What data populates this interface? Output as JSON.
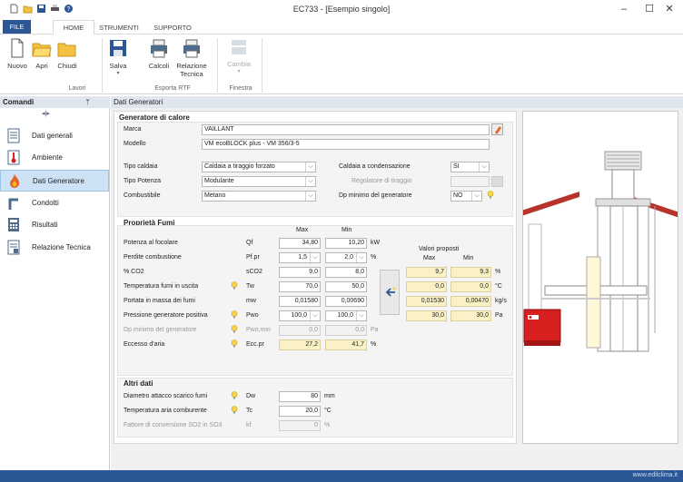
{
  "window": {
    "title": "EC733 - [Esempio singolo]"
  },
  "window_controls": {
    "min": "–",
    "max": "☐",
    "close": "✕"
  },
  "tabs": [
    {
      "label": "FILE"
    },
    {
      "label": "HOME"
    },
    {
      "label": "STRUMENTI"
    },
    {
      "label": "SUPPORTO"
    }
  ],
  "ribbon": {
    "nuovo": "Nuovo",
    "apri": "Apri",
    "chiudi": "Chiudi",
    "salva": "Salva",
    "calcoli": "Calcoli",
    "relazione1": "Relazione",
    "relazione2": "Tecnica",
    "cambia": "Cambia",
    "groups": {
      "lavori": "Lavori",
      "esporta": "Esporta RTF",
      "finestra": "Finestra"
    }
  },
  "left": {
    "header": "Comandi",
    "pin": "ᛘ",
    "collapse": "◂|▸",
    "items": [
      {
        "label": "Dati generali"
      },
      {
        "label": "Ambiente"
      },
      {
        "label": "Dati Generatore"
      },
      {
        "label": "Condotti"
      },
      {
        "label": "Risultati"
      },
      {
        "label": "Relazione Tecnica"
      }
    ]
  },
  "content": {
    "header": "Dati Generatori",
    "gen": {
      "title": "Generatore di calore",
      "marca_label": "Marca",
      "marca": "VAILLANT",
      "modello_label": "Modello",
      "modello": "VM ecoBLOCK plus - VM 356/3-5",
      "tipo_caldaia_label": "Tipo caldaia",
      "tipo_caldaia": "Caldaia a tiraggio forzato",
      "tipo_potenza_label": "Tipo Potenza",
      "tipo_potenza": "Modulante",
      "combustibile_label": "Combustibile",
      "combustibile": "Metano",
      "condensazione_label": "Caldaia a condensazione",
      "condensazione": "SI",
      "regolatore_label": "Regolatore di tiraggio",
      "dp_label": "Dp minimo del generatore",
      "dp": "NO"
    },
    "fumi": {
      "title": "Proprietà Fumi",
      "max_header": "Max",
      "min_header": "Min",
      "proposti_title": "Valori proposti",
      "proposti_max": "Max",
      "proposti_min": "Min",
      "rows": [
        {
          "label": "Potenza al focolare",
          "sym": "Qf",
          "max": "34,80",
          "min": "10,20",
          "unit": "kW"
        },
        {
          "label": "Perdite combustione",
          "sym": "Pf.pr",
          "max": "1,5",
          "min": "2,0",
          "unit": "%"
        },
        {
          "label": "% CO2",
          "sym": "sCO2",
          "max": "9,0",
          "min": "8,0",
          "unit": "",
          "pmax": "9,7",
          "pmin": "9,3",
          "punit": "%"
        },
        {
          "label": "Temperatura fumi in uscita",
          "sym": "Tw",
          "max": "70,0",
          "min": "50,0",
          "unit": "",
          "pmax": "0,0",
          "pmin": "0,0",
          "punit": "°C"
        },
        {
          "label": "Portata in massa dei fumi",
          "sym": "mw",
          "max": "0,01580",
          "min": "0,00690",
          "unit": "",
          "pmax": "0,01530",
          "pmin": "0,00470",
          "punit": "kg/s"
        },
        {
          "label": "Pressione generatore positiva",
          "sym": "Pwo",
          "max": "100,0",
          "min": "100,0",
          "unit": "",
          "pmax": "30,0",
          "pmin": "30,0",
          "punit": "Pa"
        },
        {
          "label": "Dp minimo del generatore",
          "sym": "Pwo,min",
          "max": "0,0",
          "min": "0,0",
          "unit": "Pa"
        },
        {
          "label": "Eccesso d'aria",
          "sym": "Ecc.pr",
          "max": "27,2",
          "min": "41,7",
          "unit": "%"
        }
      ]
    },
    "altri": {
      "title": "Altri dati",
      "rows": [
        {
          "label": "Diametro attacco scarico fumi",
          "sym": "Dw",
          "val": "80",
          "unit": "mm"
        },
        {
          "label": "Temperatura aria comburente",
          "sym": "Tc",
          "val": "20,0",
          "unit": "°C"
        },
        {
          "label": "Fattore di conversione SO2 in SO3",
          "sym": "kf",
          "val": "0",
          "unit": "%"
        }
      ]
    }
  },
  "status": {
    "site": "www.edilclima.it"
  },
  "colors": {
    "accent": "#2b5797",
    "yellow_field": "#fbf1c6",
    "boiler_red": "#d71f1f"
  }
}
